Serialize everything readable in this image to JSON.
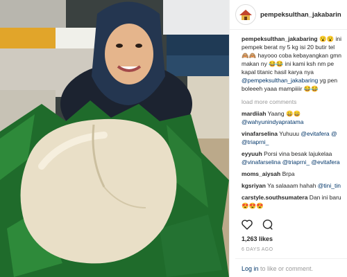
{
  "post": {
    "username": "pempeksulthan_jakabarin",
    "caption_lines": [
      {
        "user": "pempeksulthan_jakabaring",
        "text": " 😮😮 ini"
      },
      {
        "user": "",
        "text": "pempek berat ny 5 kg isi 20 butir tel"
      },
      {
        "user": "",
        "text": "🙈🙈 hayooo coba kebayangkan gmn"
      },
      {
        "user": "",
        "text": "makan ny 😂😂 ini kami ksh nm pe"
      },
      {
        "user": "",
        "text": "kapal titanic hasil karya nya"
      },
      {
        "user": "",
        "mention": "@pempeksulthan_jakabaring",
        "text": " yg pen"
      },
      {
        "user": "",
        "text": "boleeeh yaaa mampiiiir 😂😂"
      }
    ],
    "load_more": "load more comments",
    "comments": [
      {
        "user": "mardiiah",
        "text": " Yaang 😄😄",
        "line2_mention": "@wahyunindyapratama",
        "line2_text": ""
      },
      {
        "user": "vinafarselina",
        "text": " Yuhuuu ",
        "mention": "@evitafera",
        "tail": " @",
        "line2_mention": "@triaprni_",
        "line2_text": ""
      },
      {
        "user": "eyyuuh",
        "text": " Porsi vina besak lajukelaa",
        "line2_mention": "@vinafarselina @triaprni_",
        "line2_text": " @evitafera"
      },
      {
        "user": "moms_aiysah",
        "text": " Brpa"
      },
      {
        "user": "kgsriyan",
        "text": " Ya salaaam hahah ",
        "mention": "@tini_tin"
      },
      {
        "user": "carstyle.southsumatera",
        "text": " Dan ini baru",
        "line2_text": "😍😍😍"
      }
    ],
    "likes": "1,263 likes",
    "time_ago": "6 DAYS AGO",
    "footer_link": "Log in",
    "footer_text": " to like or comment."
  },
  "colors": {
    "link": "#003569",
    "text": "#262626",
    "muted": "#999999"
  },
  "icons": [
    "heart-icon",
    "comment-icon",
    "avatar"
  ]
}
